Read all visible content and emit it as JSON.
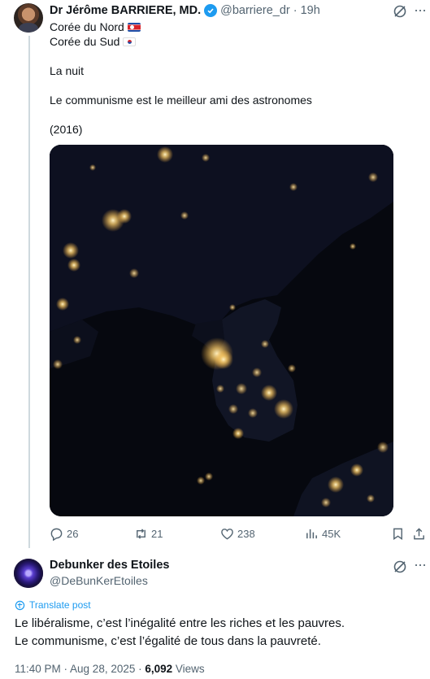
{
  "tweet1": {
    "author_name": "Dr Jérôme BARRIERE, MD.",
    "handle": "@barriere_dr",
    "separator": "·",
    "time": "19h",
    "verified": true,
    "lines": [
      {
        "text": "Corée du Nord",
        "flag": "north-korea-flag"
      },
      {
        "text": "Corée du Sud",
        "flag": "south-korea-flag"
      },
      {
        "text": ""
      },
      {
        "text": "La nuit"
      },
      {
        "text": ""
      },
      {
        "text": "Le communisme est le meilleur ami des astronomes"
      },
      {
        "text": ""
      },
      {
        "text": "(2016)"
      }
    ],
    "stats": {
      "replies": "26",
      "reposts": "21",
      "likes": "238",
      "views": "45K"
    }
  },
  "tweet2": {
    "author_name": "Debunker des Etoiles",
    "handle": "@DeBunKerEtoiles",
    "translate_label": "Translate post",
    "text_line1": "Le libéralisme, c’est l’inégalité entre les riches et les pauvres.",
    "text_line2": "Le communisme, c’est l’égalité de tous dans la pauvreté.",
    "time": "11:40 PM · Aug 28, 2025 · ",
    "views_count": "6,092",
    "views_label": " Views"
  },
  "colors": {
    "accent": "#1d9bf0",
    "secondary_text": "#536471",
    "city_lights": "#ffd98a"
  }
}
